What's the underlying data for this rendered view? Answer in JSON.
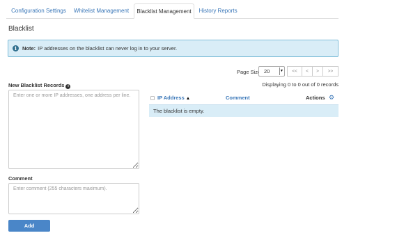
{
  "tabs": [
    {
      "label": "Configuration Settings",
      "active": false
    },
    {
      "label": "Whitelist Management",
      "active": false
    },
    {
      "label": "Blacklist Management",
      "active": true
    },
    {
      "label": "History Reports",
      "active": false
    }
  ],
  "page_title": "Blacklist",
  "note": {
    "icon": "info-icon",
    "bold": "Note:",
    "text": "IP addresses on the blacklist can never log in to your server."
  },
  "new_records": {
    "label": "New Blacklist Records",
    "placeholder": "Enter one or more IP addresses, one address per line."
  },
  "comment": {
    "label": "Comment",
    "placeholder": "Enter comment (255 characters maximum)."
  },
  "add_button": "Add",
  "pagination": {
    "page_size_label": "Page Size",
    "page_size_value": "20",
    "first": "<<",
    "prev": "<",
    "next": ">",
    "last": ">>",
    "display_text": "Displaying 0 to 0 out of 0 records"
  },
  "table": {
    "columns": {
      "ip": "IP Address",
      "sort_indicator": "▲",
      "comment": "Comment",
      "actions": "Actions"
    },
    "empty_text": "The blacklist is empty."
  },
  "colors": {
    "accent": "#3a77b8",
    "info_bg": "#d9edf7",
    "button": "#4a86c8"
  }
}
